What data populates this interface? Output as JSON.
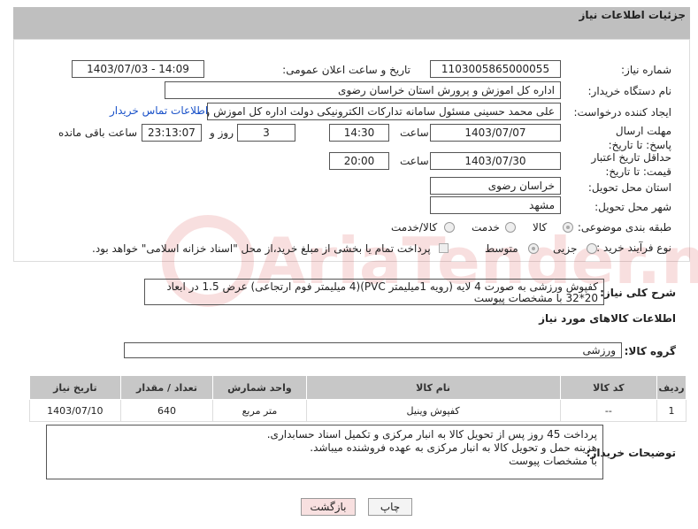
{
  "header": {
    "title": "جزئیات اطلاعات نیاز"
  },
  "fields": {
    "need_number_label": "شماره نیاز:",
    "need_number": "1103005865000055",
    "announce_label": "تاریخ و ساعت اعلان عمومی:",
    "announce_value": "1403/07/03 - 14:09",
    "buyer_org_label": "نام دستگاه خریدار:",
    "buyer_org": "اداره کل اموزش و پرورش استان خراسان رضوی",
    "creator_label": "ایجاد کننده درخواست:",
    "creator": "علی محمد حسینی مسئول سامانه تدارکات الکترونیکی دولت اداره کل اموزش و",
    "contact_link": "اطلاعات تماس خریدار",
    "deadline_label": "مهلت ارسال پاسخ: تا تاریخ:",
    "deadline_date": "1403/07/07",
    "time_label": "ساعت",
    "deadline_time": "14:30",
    "days_value": "3",
    "days_label": "روز و",
    "remaining_time": "23:13:07",
    "remaining_label": "ساعت باقی مانده",
    "validity_label": "حداقل تاریخ اعتبار قیمت: تا تاریخ:",
    "validity_date": "1403/07/30",
    "validity_time_label": "ساعت",
    "validity_time": "20:00",
    "province_label": "استان محل تحویل:",
    "province": "خراسان رضوی",
    "city_label": "شهر محل تحویل:",
    "city": "مشهد",
    "category_label": "طبقه بندی موضوعی:",
    "category_options": [
      "کالا",
      "خدمت",
      "کالا/خدمت"
    ],
    "process_label": "نوع فرآیند خرید :",
    "process_options": [
      "جزیی",
      "متوسط"
    ],
    "payment_note": "پرداخت تمام یا بخشی از مبلغ خرید،از محل \"اسناد خزانه اسلامی\" خواهد بود."
  },
  "description": {
    "label": "شرح کلی نیاز:",
    "text": "کفپوش ورزشی به صورت 4 لایه (رویه 1میلیمتر PVC)(4 میلیمتر فوم ارتجاعی) عرض 1.5 در ابعاد 20*32 با مشخصات پیوست"
  },
  "goods_section": {
    "title": "اطلاعات کالاهای مورد نیاز",
    "group_label": "گروه کالا:",
    "group_value": "ورزشی"
  },
  "table": {
    "headers": [
      "ردیف",
      "کد کالا",
      "نام کالا",
      "واحد شمارش",
      "تعداد / مقدار",
      "تاریخ نیاز"
    ],
    "rows": [
      [
        "1",
        "--",
        "کفپوش وینیل",
        "متر مربع",
        "640",
        "1403/07/10"
      ]
    ]
  },
  "buyer_notes": {
    "label": "توضیحات خریدار:",
    "lines": [
      "پرداخت 45 روز پس از تحویل کالا به انبار مرکزی و تکمیل اسناد حسابداری.",
      "هزینه حمل و تحویل کالا به انبار مرکزی به عهده فروشنده میباشد.",
      "با مشخصات پیوست"
    ]
  },
  "buttons": {
    "print": "چاپ",
    "back": "بازگشت"
  },
  "watermark_text": "AriaTender.neT",
  "colors": {
    "header_bg": "#bfbfbf",
    "table_header_bg": "#c7c7c7",
    "link": "#1a52c9",
    "back_button": "#f8e0e0"
  }
}
